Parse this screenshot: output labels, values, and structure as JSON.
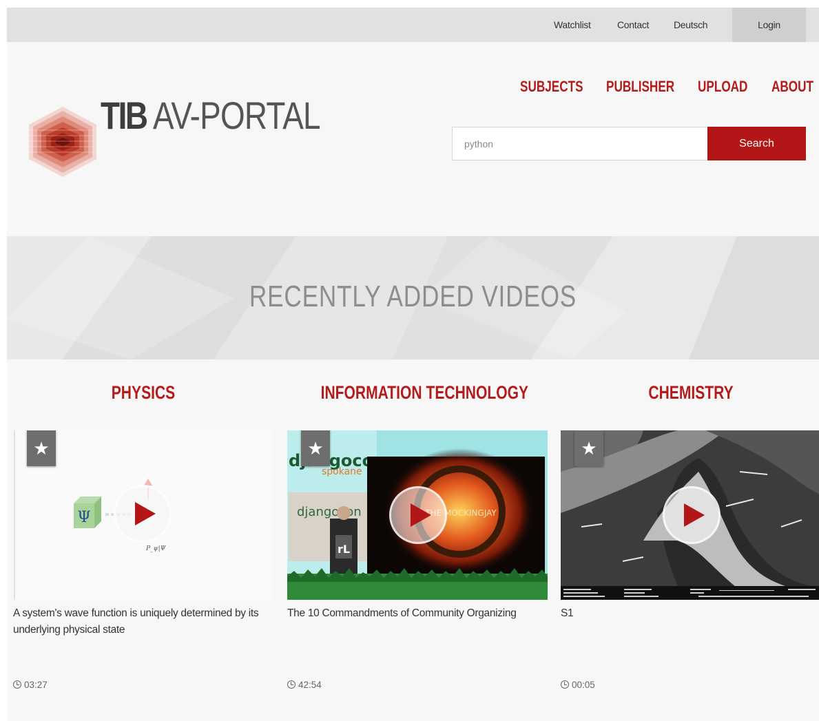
{
  "topbar": {
    "watchlist": "Watchlist",
    "contact": "Contact",
    "language": "Deutsch",
    "login": "Login"
  },
  "header": {
    "logo_bold": "TIB",
    "logo_light": "AV-PORTAL",
    "nav": [
      "SUBJECTS",
      "PUBLISHER",
      "UPLOAD",
      "ABOUT"
    ],
    "search": {
      "placeholder": "python",
      "button": "Search"
    }
  },
  "banner": {
    "title": "RECENTLY ADDED VIDEOS"
  },
  "categories": [
    {
      "name": "PHYSICS",
      "video": {
        "title": "A system's wave function is uniquely determined by its underlying physical state",
        "duration": "03:27",
        "thumb_text_psi": "Ψ",
        "thumb_text_label": "P_ψ|Ψ"
      }
    },
    {
      "name": "INFORMATION TECHNOLOGY",
      "video": {
        "title": "The 10 Commandments of Community Organizing",
        "duration": "42:54",
        "thumb_text_brand": "djangocon",
        "thumb_text_city": "spokane",
        "thumb_text_overlay": "THE MOCKINGJAY",
        "thumb_text_sign": "rL"
      }
    },
    {
      "name": "CHEMISTRY",
      "video": {
        "title": "S1",
        "duration": "00:05"
      }
    }
  ],
  "colors": {
    "accent": "#b41b1b",
    "button": "#b31616",
    "topbar": "#e1e1e1",
    "banner": "#e2e2e2"
  },
  "icons": {
    "favorite": "star-icon",
    "play": "play-icon",
    "duration": "clock-icon"
  }
}
